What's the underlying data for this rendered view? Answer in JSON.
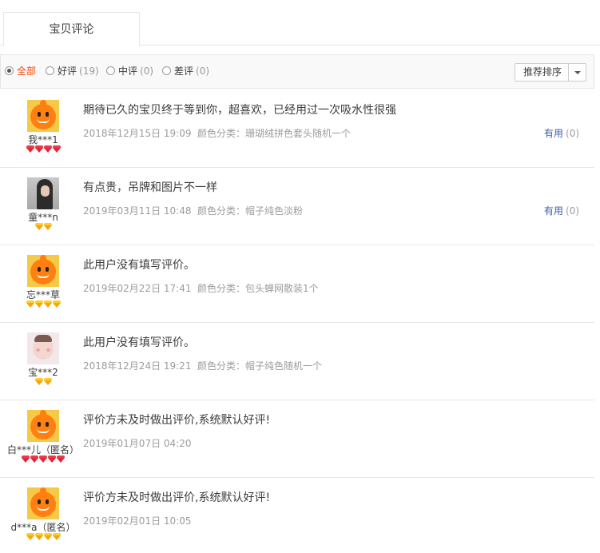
{
  "tabs": [
    {
      "label": "宝贝评论"
    }
  ],
  "filters": [
    {
      "label": "全部",
      "count": "",
      "checked": true
    },
    {
      "label": "好评",
      "count": "(19)",
      "checked": false
    },
    {
      "label": "中评",
      "count": "(0)",
      "checked": false
    },
    {
      "label": "差评",
      "count": "(0)",
      "checked": false
    }
  ],
  "sort": {
    "label": "推荐排序"
  },
  "colors": {
    "active_filter": "#ff4400",
    "link": "#3d5fa8",
    "muted": "#9c9c9c",
    "border": "#e6e6e6"
  },
  "reviews": [
    {
      "user": "我***1",
      "avatar": "orange-mascot-icon",
      "badge_type": "heart",
      "badge_count": 4,
      "content": "期待已久的宝贝终于等到你，超喜欢，已经用过一次吸水性很强",
      "date": "2018年12月15日 19:09",
      "sku": "颜色分类：珊瑚绒拼色套头随机一个",
      "useful_label": "有用",
      "useful_count": "(0)"
    },
    {
      "user": "童***n",
      "avatar": "girl-photo-icon",
      "badge_type": "diamond",
      "badge_count": 2,
      "content": "有点贵，吊牌和图片不一样",
      "date": "2019年03月11日 10:48",
      "sku": "颜色分类：帽子纯色淡粉",
      "useful_label": "有用",
      "useful_count": "(0)"
    },
    {
      "user": "忘***草",
      "avatar": "orange-mascot-icon",
      "badge_type": "diamond",
      "badge_count": 4,
      "content": "此用户没有填写评价。",
      "date": "2019年02月22日 17:41",
      "sku": "颜色分类：包头蝉网散装1个",
      "useful_label": "",
      "useful_count": ""
    },
    {
      "user": "宝***2",
      "avatar": "baby-photo-icon",
      "badge_type": "diamond",
      "badge_count": 2,
      "content": "此用户没有填写评价。",
      "date": "2018年12月24日 19:21",
      "sku": "颜色分类：帽子纯色随机一个",
      "useful_label": "",
      "useful_count": ""
    },
    {
      "user": "白***儿（匿名）",
      "avatar": "orange-mascot-icon",
      "badge_type": "heart",
      "badge_count": 5,
      "content": "评价方未及时做出评价,系统默认好评!",
      "date": "2019年01月07日 04:20",
      "sku": "",
      "useful_label": "",
      "useful_count": ""
    },
    {
      "user": "d***a（匿名）",
      "avatar": "orange-mascot-icon",
      "badge_type": "diamond",
      "badge_count": 4,
      "content": "评价方未及时做出评价,系统默认好评!",
      "date": "2019年02月01日 10:05",
      "sku": "",
      "useful_label": "",
      "useful_count": ""
    }
  ]
}
